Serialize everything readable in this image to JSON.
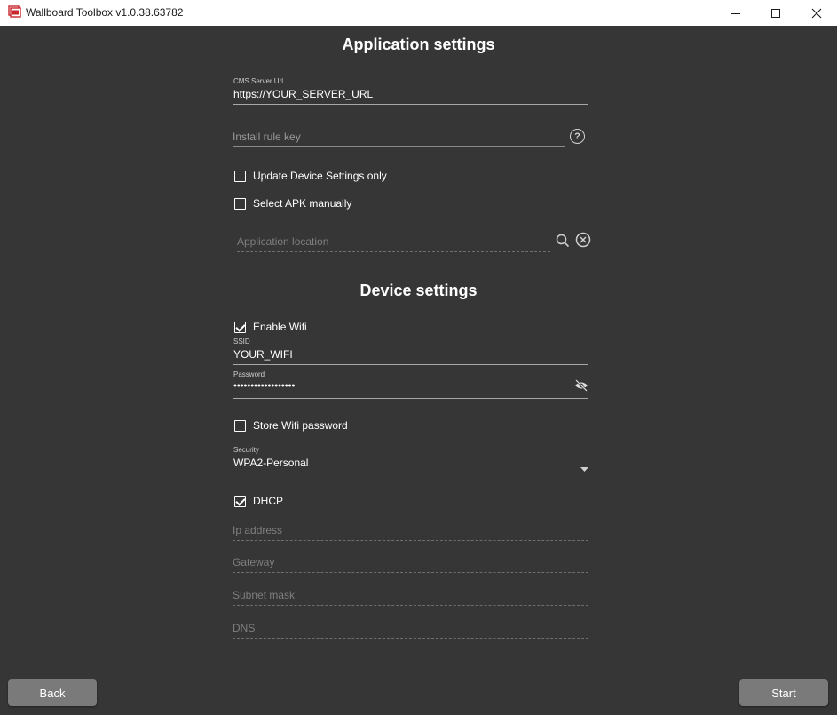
{
  "window": {
    "title": "Wallboard Toolbox v1.0.38.63782",
    "minimize_icon": "minimize-icon",
    "maximize_icon": "maximize-icon",
    "close_icon": "close-icon"
  },
  "application_settings": {
    "heading": "Application settings",
    "cms_server_url": {
      "label": "CMS Server Url",
      "value": "https://YOUR_SERVER_URL"
    },
    "install_rule_key": {
      "placeholder": "Install rule key",
      "help_icon": "question-circle-icon",
      "help_glyph": "?"
    },
    "update_device_settings_only": {
      "label": "Update Device Settings only",
      "checked": false
    },
    "select_apk_manually": {
      "label": "Select APK manually",
      "checked": false
    },
    "application_location": {
      "placeholder": "Application location",
      "search_icon": "search-icon",
      "clear_icon": "clear-circle-icon"
    }
  },
  "device_settings": {
    "heading": "Device settings",
    "enable_wifi": {
      "label": "Enable Wifi",
      "checked": true
    },
    "ssid": {
      "label": "SSID",
      "value": "YOUR_WIFI"
    },
    "password": {
      "label": "Password",
      "value": "••••••••••••••••••",
      "visibility_icon": "eye-slash-icon"
    },
    "store_wifi_password": {
      "label": "Store Wifi password",
      "checked": false
    },
    "security": {
      "label": "Security",
      "value": "WPA2-Personal"
    },
    "dhcp": {
      "label": "DHCP",
      "checked": true
    },
    "ip_address": {
      "placeholder": "Ip address"
    },
    "gateway": {
      "placeholder": "Gateway"
    },
    "subnet_mask": {
      "placeholder": "Subnet mask"
    },
    "dns": {
      "placeholder": "DNS"
    }
  },
  "footer": {
    "back_label": "Back",
    "start_label": "Start"
  },
  "colors": {
    "background": "#363636",
    "button": "#7a7a7a",
    "text": "#ffffff"
  }
}
